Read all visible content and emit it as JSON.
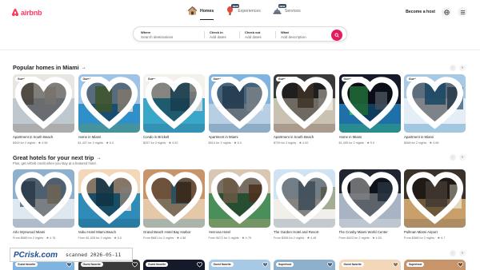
{
  "brand": {
    "name": "airbnb",
    "color": "#FF385C"
  },
  "nav": {
    "tabs": [
      {
        "label": "Homes",
        "icon": "house-icon",
        "active": true
      },
      {
        "label": "Experiences",
        "icon": "balloon-icon",
        "badge": "NEW"
      },
      {
        "label": "Services",
        "icon": "service-bell-icon",
        "badge": "NEW"
      }
    ],
    "host_link": "Become a host",
    "globe_icon": "globe-icon",
    "menu_icon": "hamburger-menu-icon"
  },
  "search": {
    "where": {
      "title": "Where",
      "placeholder": "Search destinations"
    },
    "checkin": {
      "title": "Check in",
      "placeholder": "Add dates"
    },
    "checkout": {
      "title": "Check out",
      "placeholder": "Add dates"
    },
    "who": {
      "title": "Who",
      "placeholder": "Add guests"
    },
    "what": {
      "title": "What",
      "placeholder": "Add description"
    },
    "button_icon": "search-icon",
    "accent": "#E31C5F"
  },
  "sections": [
    {
      "title": "Popular homes in Miami",
      "subtitle": "",
      "cards": [
        {
          "badge": "Guest favorite",
          "title": "Apartment in South Beach",
          "meta": "$409 for 2 nights · ★ 4.96"
        },
        {
          "badge": "Guest favorite",
          "title": "Home in Miami",
          "meta": "$1,437 for 2 nights · ★ 5.0"
        },
        {
          "badge": "Guest favorite",
          "title": "Condo in Brickell",
          "meta": "$257 for 2 nights · ★ 4.92"
        },
        {
          "badge": "Guest favorite",
          "title": "Apartment in Miami",
          "meta": "$510 for 2 nights · ★ 5.0"
        },
        {
          "badge": "Guest favorite",
          "title": "Apartment in South Beach",
          "meta": "$799 for 2 nights · ★ 4.92"
        },
        {
          "badge": "Guest favorite",
          "title": "Home in Miami",
          "meta": "$1,495 for 2 nights · ★ 5.0"
        },
        {
          "badge": "Guest favorite",
          "title": "Apartment in Miami",
          "meta": "$468 for 2 nights · ★ 4.96"
        }
      ]
    },
    {
      "title": "Great hotels for your next trip",
      "subtitle": "Plus, get Airbnb credit when you stay at a featured hotel.",
      "cards": [
        {
          "badge": "",
          "title": "Arlo Wynwood Miami",
          "meta": "From $585 for 2 nights · ★ 4.76"
        },
        {
          "badge": "",
          "title": "Nobu Hotel Miami Beach",
          "meta": "From $1,028 for 2 nights · ★ 5.0"
        },
        {
          "badge": "",
          "title": "Grand Beach Hotel Bay Harbor",
          "meta": "From $681 for 2 nights · ★ 4.88"
        },
        {
          "badge": "",
          "title": "Henrosa Hotel",
          "meta": "From $472 for 2 nights · ★ 4.75"
        },
        {
          "badge": "",
          "title": "The Garden Hotel and Resort",
          "meta": "From $398 for 2 nights · ★ 4.48"
        },
        {
          "badge": "",
          "title": "The Crosby Miami World Center",
          "meta": "From $403 for 2 nights · ★ 4.63"
        },
        {
          "badge": "",
          "title": "Pullman Miami Airport",
          "meta": "From $368 for 2 nights · ★ 4.7"
        }
      ]
    }
  ],
  "row3_badges": [
    "Guest favorite",
    "Guest favorite",
    "Guest favorite",
    "Guest favorite",
    "Superhost",
    "Guest favorite",
    "Superhost"
  ],
  "watermark": {
    "logo": "PCrisk.com",
    "scanned": "scanned 2026-05-11"
  }
}
